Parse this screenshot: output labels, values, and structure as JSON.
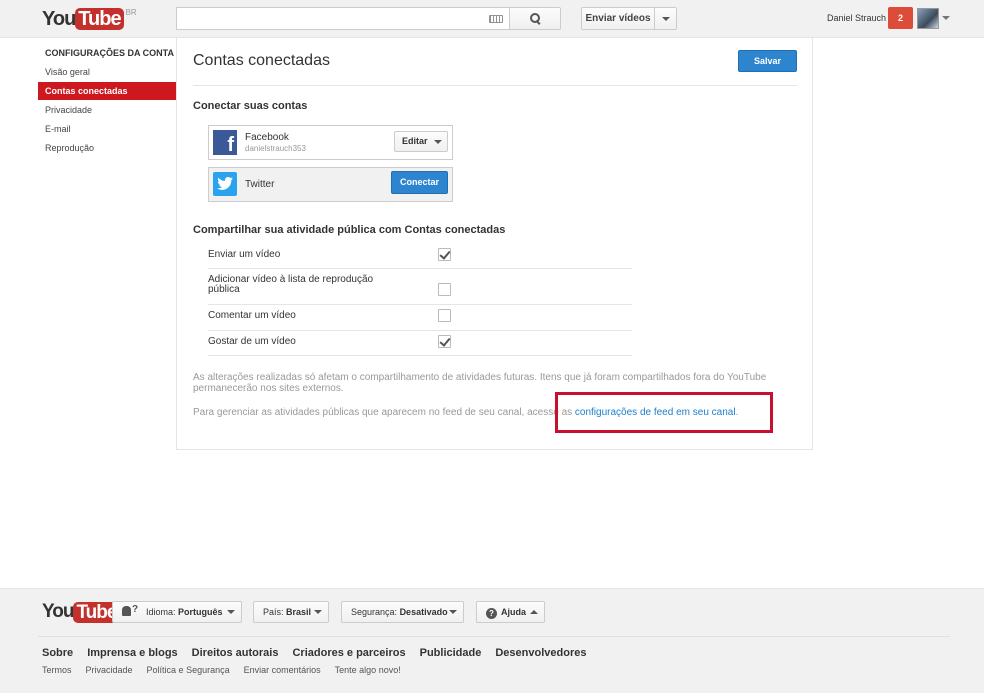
{
  "header": {
    "logo_you": "You",
    "logo_tube": "Tube",
    "logo_region": "BR",
    "search_value": "",
    "upload_label": "Enviar vídeos",
    "username": "Daniel Strauch",
    "notifications_count": "2"
  },
  "sidebar": {
    "title": "CONFIGURAÇÕES DA CONTA",
    "items": [
      {
        "label": "Visão geral",
        "active": false
      },
      {
        "label": "Contas conectadas",
        "active": true
      },
      {
        "label": "Privacidade",
        "active": false
      },
      {
        "label": "E-mail",
        "active": false
      },
      {
        "label": "Reprodução",
        "active": false
      }
    ]
  },
  "main": {
    "title": "Contas conectadas",
    "save_label": "Salvar",
    "connect_section_title": "Conectar suas contas",
    "accounts": {
      "facebook": {
        "name": "Facebook",
        "username": "danielstrauch353",
        "action_label": "Editar",
        "icon": "facebook-icon"
      },
      "twitter": {
        "name": "Twitter",
        "action_label": "Conectar",
        "icon": "twitter-icon"
      }
    },
    "share_section_title": "Compartilhar sua atividade pública com Contas conectadas",
    "share_options": [
      {
        "label": "Enviar um vídeo",
        "checked": true
      },
      {
        "label": "Adicionar vídeo à lista de reprodução pública",
        "checked": false
      },
      {
        "label": "Comentar um vídeo",
        "checked": false
      },
      {
        "label": "Gostar de um vídeo",
        "checked": true
      }
    ],
    "note_text": "As alterações realizadas só afetam o compartilhamento de atividades futuras. Itens que já foram compartilhados fora do YouTube permanecerão nos sites externos.",
    "feed_text": "Para gerenciar as atividades públicas que aparecem no feed de seu canal, acesse as ",
    "feed_link": "configurações de feed em seu canal",
    "feed_end": ".",
    "highlight_color": "#c8102e"
  },
  "footer": {
    "language_label": "Idioma:",
    "language_value": "Português",
    "country_label": "País:",
    "country_value": "Brasil",
    "safety_label": "Segurança:",
    "safety_value": "Desativado",
    "help_label": "Ajuda",
    "links_primary": [
      "Sobre",
      "Imprensa e blogs",
      "Direitos autorais",
      "Criadores e parceiros",
      "Publicidade",
      "Desenvolvedores"
    ],
    "links_secondary": [
      "Termos",
      "Privacidade",
      "Política e Segurança",
      "Enviar comentários",
      "Tente algo novo!"
    ]
  },
  "colors": {
    "brand_red": "#cc181e",
    "primary_blue": "#2d85d0",
    "link_blue": "#1b7fcc",
    "facebook_blue": "#3b5998",
    "twitter_blue": "#2aa3ef"
  }
}
